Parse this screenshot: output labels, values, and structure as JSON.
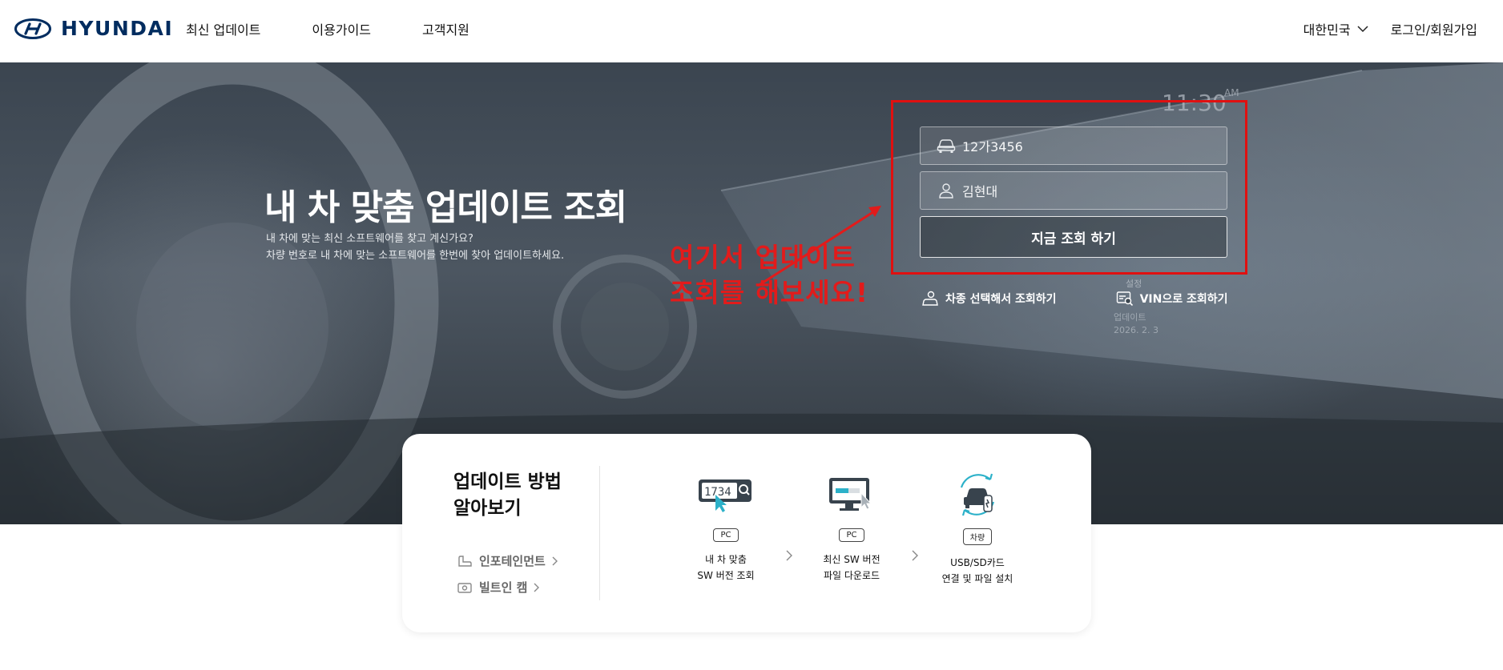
{
  "header": {
    "brand": "HYUNDAI",
    "nav": [
      "최신 업데이트",
      "이용가이드",
      "고객지원"
    ],
    "language": "대한민국",
    "login": "로그인/회원가입"
  },
  "hero": {
    "title": "내 차 맞춤 업데이트 조회",
    "subtitle_lines": [
      "내 차에 맞는 최신 소프트웨어를 찾고 계신가요?",
      "차량 번호로 내 차에 맞는 소프트웨어를 한번에 찾아 업데이트하세요."
    ],
    "plate_value": "12가3456",
    "name_value": "김현대",
    "search_button": "지금 조회 하기",
    "alt_links": [
      "차종 선택해서 조회하기",
      "VIN으로 조회하기"
    ],
    "annotation_lines": [
      "여기서 업데이트",
      "조회를 해보세요!"
    ],
    "background_texts": [
      "11:30",
      "AM",
      "설정",
      "업데이트",
      "2026. 2. 3"
    ]
  },
  "update_card": {
    "title_lines": [
      "업데이트 방법",
      "알아보기"
    ],
    "links": [
      "인포테인먼트",
      "빌트인 캠"
    ],
    "steps": [
      {
        "badge": "PC",
        "label_lines": [
          "내 차 맞춤",
          "SW 버전 조회"
        ],
        "icon_text": "1734"
      },
      {
        "badge": "PC",
        "label_lines": [
          "최신 SW 버전",
          "파일 다운로드"
        ]
      },
      {
        "badge": "차량",
        "label_lines": [
          "USB/SD카드",
          "연결 및 파일 설치"
        ]
      }
    ]
  },
  "colors": {
    "brand": "#002c5f",
    "annotation": "#e21b1b"
  }
}
